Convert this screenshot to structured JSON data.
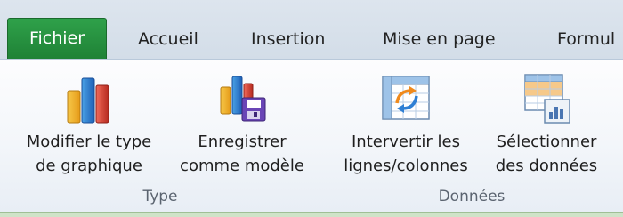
{
  "tabs": {
    "file": "Fichier",
    "home": "Accueil",
    "insert": "Insertion",
    "layout": "Mise en page",
    "formulas": "Formul"
  },
  "groups": {
    "type": {
      "label": "Type",
      "change_chart_type": {
        "line1": "Modifier le type",
        "line2": "de graphique",
        "icon": "chart-type-icon"
      },
      "save_as_template": {
        "line1": "Enregistrer",
        "line2": "comme modèle",
        "icon": "save-template-icon"
      }
    },
    "data": {
      "label": "Données",
      "switch_row_column": {
        "line1": "Intervertir les",
        "line2": "lignes/colonnes",
        "icon": "switch-row-column-icon"
      },
      "select_data": {
        "line1": "Sélectionner",
        "line2": "des données",
        "icon": "select-data-icon"
      }
    }
  },
  "colors": {
    "file_tab": "#2a9a46",
    "ribbon_bg": "#f3f6fa"
  }
}
